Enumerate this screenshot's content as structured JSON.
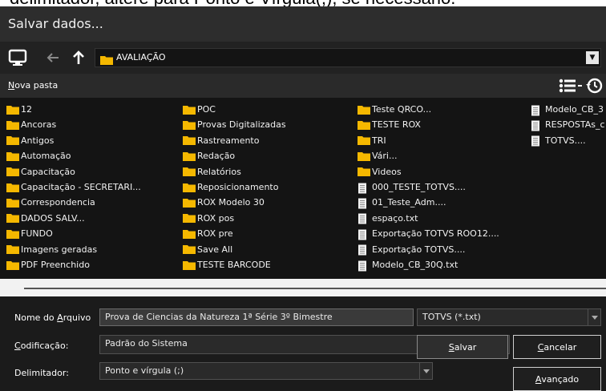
{
  "overflow_text": "delimitador, altere para Ponto e Vírgula(;), se necessário.",
  "dialog": {
    "title": "Salvar dados...",
    "path": "AVALIAÇÃO",
    "new_folder_prefix": "N",
    "new_folder_rest": "ova pasta"
  },
  "columns": [
    {
      "items": [
        {
          "name": "12",
          "type": "folder"
        },
        {
          "name": "Ancoras",
          "type": "folder"
        },
        {
          "name": "Antigos",
          "type": "folder"
        },
        {
          "name": "Automação",
          "type": "folder"
        },
        {
          "name": "Capacitação",
          "type": "folder"
        },
        {
          "name": "Capacitação - SECRETARI...",
          "type": "folder"
        },
        {
          "name": "Correspondencia",
          "type": "folder"
        },
        {
          "name": "DADOS SALV...",
          "type": "folder"
        },
        {
          "name": "FUNDO",
          "type": "folder"
        },
        {
          "name": "Imagens geradas",
          "type": "folder"
        },
        {
          "name": "PDF Preenchido",
          "type": "folder"
        }
      ]
    },
    {
      "items": [
        {
          "name": "POC",
          "type": "folder"
        },
        {
          "name": "Provas Digitalizadas",
          "type": "folder"
        },
        {
          "name": "Rastreamento",
          "type": "folder"
        },
        {
          "name": "Redação",
          "type": "folder"
        },
        {
          "name": "Relatórios",
          "type": "folder"
        },
        {
          "name": "Reposicionamento",
          "type": "folder"
        },
        {
          "name": "ROX Modelo 30",
          "type": "folder"
        },
        {
          "name": "ROX pos",
          "type": "folder"
        },
        {
          "name": "ROX pre",
          "type": "folder"
        },
        {
          "name": "Save All",
          "type": "folder"
        },
        {
          "name": "TESTE BARCODE",
          "type": "folder"
        }
      ]
    },
    {
      "items": [
        {
          "name": "Teste QRCO...",
          "type": "folder"
        },
        {
          "name": "TESTE ROX",
          "type": "folder"
        },
        {
          "name": "TRI",
          "type": "folder"
        },
        {
          "name": "Vári...",
          "type": "folder"
        },
        {
          "name": "Videos",
          "type": "folder"
        },
        {
          "name": "000_TESTE_TOTVS....",
          "type": "file"
        },
        {
          "name": "01_Teste_Adm....",
          "type": "file"
        },
        {
          "name": "espaço.txt",
          "type": "file"
        },
        {
          "name": "Exportação TOTVS ROO12....",
          "type": "file"
        },
        {
          "name": "Exportação TOTVS....",
          "type": "file"
        },
        {
          "name": "Modelo_CB_30Q.txt",
          "type": "file"
        }
      ]
    },
    {
      "items": [
        {
          "name": "Modelo_CB_3",
          "type": "file"
        },
        {
          "name": "RESPOSTAs_c",
          "type": "file"
        },
        {
          "name": "TOTVS....",
          "type": "file"
        }
      ]
    }
  ],
  "form": {
    "filename_label_pre": "Nome do ",
    "filename_label_u": "A",
    "filename_label_post": "rquivo",
    "filename_value": "Prova de Ciencias da Natureza 1ª Série 3º Bimestre",
    "filetype_value": "TOTVS (*.txt)",
    "encoding_label_u": "C",
    "encoding_label_post": "odificação:",
    "encoding_value": "Padrão do Sistema",
    "delimiter_label": "Delimitador:",
    "delimiter_value": "Ponto e vírgula (;)"
  },
  "buttons": {
    "save_u": "S",
    "save_rest": "alvar",
    "cancel_u": "C",
    "cancel_rest": "ancelar",
    "advanced_u": "A",
    "advanced_rest": "vançado"
  },
  "colors": {
    "folder": "#f5b800",
    "dialog_bg": "#1b1b1b",
    "list_bg": "#141414"
  }
}
